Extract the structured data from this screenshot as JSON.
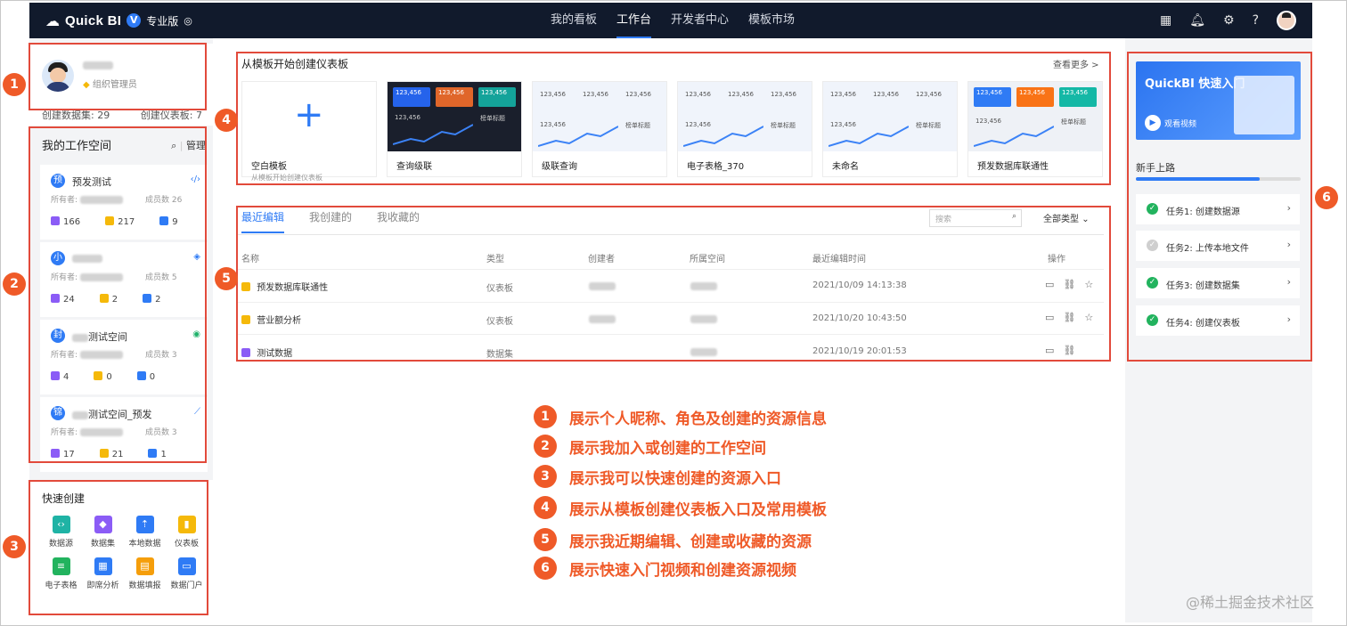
{
  "topbar": {
    "brand": "Quick BI",
    "edition": "专业版",
    "nav": [
      "我的看板",
      "工作台",
      "开发者中心",
      "模板市场"
    ],
    "active_nav": "工作台"
  },
  "profile": {
    "role": "组织管理员",
    "datasets_label": "创建数据集: 29",
    "dashboards_label": "创建仪表板: 7"
  },
  "workspace": {
    "title": "我的工作空间",
    "manage": "管理",
    "owner_label": "所有者:",
    "members_label": "成员数",
    "items": [
      {
        "badge": "预",
        "name": "预发测试",
        "members": "26",
        "c1": "166",
        "c2": "217",
        "c3": "9"
      },
      {
        "badge": "小",
        "name": "",
        "members": "5",
        "c1": "24",
        "c2": "2",
        "c3": "2"
      },
      {
        "badge": "封",
        "name": "测试空间",
        "members": "3",
        "c1": "4",
        "c2": "0",
        "c3": "0"
      },
      {
        "badge": "锦",
        "name": "测试空间_预发",
        "members": "3",
        "c1": "17",
        "c2": "21",
        "c3": "1"
      }
    ]
  },
  "quick_create": {
    "title": "快速创建",
    "items": [
      "数据源",
      "数据集",
      "本地数据",
      "仪表板",
      "电子表格",
      "即席分析",
      "数据填报",
      "数据门户"
    ]
  },
  "templates": {
    "title": "从模板开始创建仪表板",
    "more": "查看更多 >",
    "blank_label": "空白模板",
    "blank_sub": "从模板开始创建仪表板",
    "tile_value": "123,456",
    "tile_tag": "榜单标题",
    "items": [
      "查询级联",
      "级联查询",
      "电子表格_370",
      "未命名",
      "预发数据库联通性"
    ]
  },
  "recent": {
    "tabs": [
      "最近编辑",
      "我创建的",
      "我收藏的"
    ],
    "search_placeholder": "搜索",
    "filter": "全部类型",
    "headers": [
      "名称",
      "类型",
      "创建者",
      "所属空间",
      "最近编辑时间",
      "操作"
    ],
    "rows": [
      {
        "name": "预发数据库联通性",
        "type": "仪表板",
        "time": "2021/10/09 14:13:38"
      },
      {
        "name": "营业额分析",
        "type": "仪表板",
        "time": "2021/10/20 10:43:50"
      },
      {
        "name": "测试数据",
        "type": "数据集",
        "time": "2021/10/19 20:01:53"
      }
    ]
  },
  "notes": [
    {
      "num": "1",
      "text": "展示个人昵称、角色及创建的资源信息"
    },
    {
      "num": "2",
      "text": "展示我加入或创建的工作空间"
    },
    {
      "num": "3",
      "text": "展示我可以快速创建的资源入口"
    },
    {
      "num": "4",
      "text": "展示从模板创建仪表板入口及常用模板"
    },
    {
      "num": "5",
      "text": "展示我近期编辑、创建或收藏的资源"
    },
    {
      "num": "6",
      "text": "展示快速入门视频和创建资源视频"
    }
  ],
  "markers": [
    "1",
    "2",
    "3",
    "4",
    "5",
    "6"
  ],
  "right": {
    "banner_title": "QuickBI 快速入门",
    "watch": "观看视频",
    "guide_title": "新手上路",
    "progress": 0.75,
    "tasks": [
      {
        "label": "任务1:  创建数据源",
        "done": true
      },
      {
        "label": "任务2:  上传本地文件",
        "done": false
      },
      {
        "label": "任务3:  创建数据集",
        "done": true
      },
      {
        "label": "任务4:  创建仪表板",
        "done": true
      }
    ]
  },
  "watermark": "@稀土掘金技术社区",
  "colors": {
    "accent": "#2f7bf5",
    "annotation": "#ef5a28",
    "box": "#e24a3b",
    "topbar": "#111a2c"
  }
}
